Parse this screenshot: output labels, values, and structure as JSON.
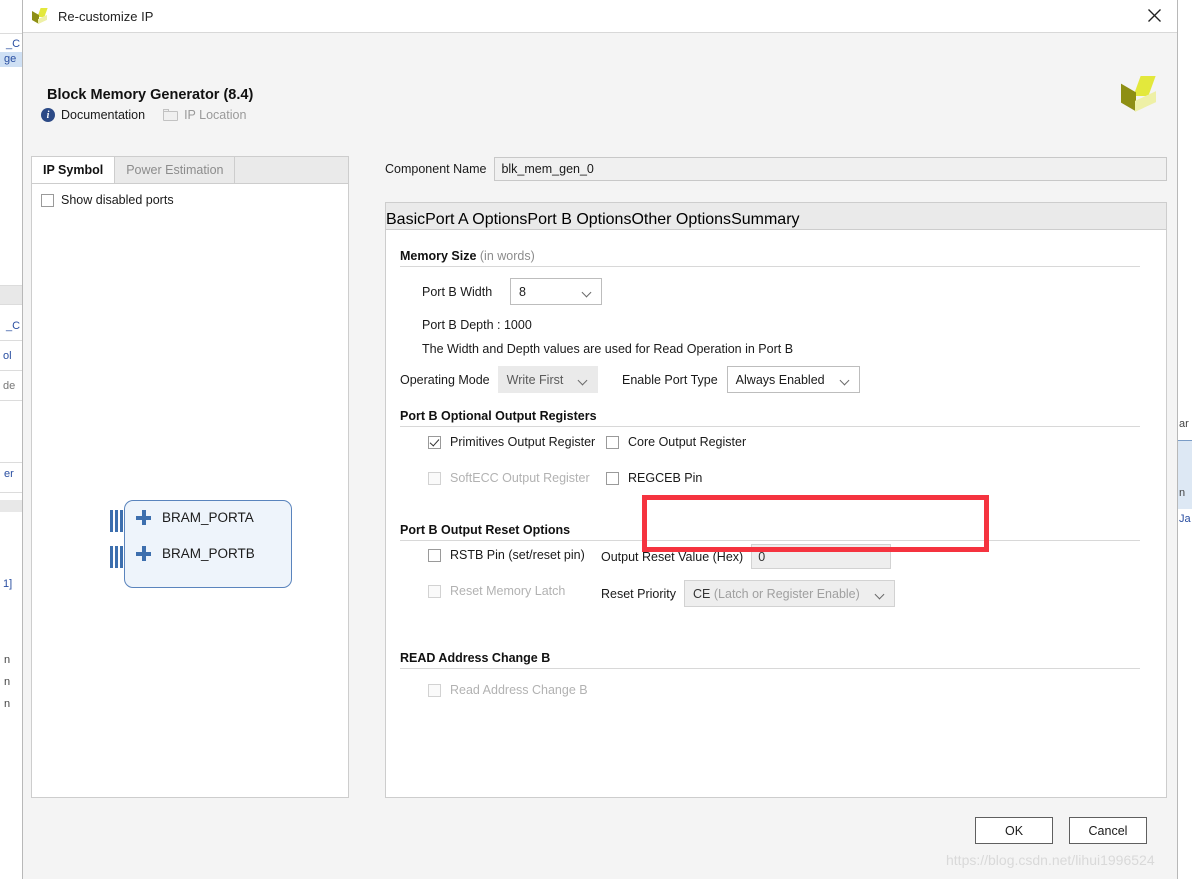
{
  "window": {
    "title": "Re-customize IP",
    "close_icon": "close-icon",
    "logo_icon": "xilinx-logo-icon"
  },
  "header": {
    "ip_title": "Block Memory Generator (8.4)",
    "links": [
      {
        "label": "Documentation",
        "icon": "info-icon",
        "enabled": true
      },
      {
        "label": "IP Location",
        "icon": "folder-icon",
        "enabled": false
      }
    ]
  },
  "left_panel": {
    "tabs": [
      {
        "label": "IP Symbol",
        "active": true
      },
      {
        "label": "Power Estimation",
        "active": false
      }
    ],
    "show_disabled_ports": {
      "label": "Show disabled ports",
      "checked": false
    },
    "symbol": {
      "ports": [
        {
          "label": "BRAM_PORTA",
          "expand_icon": "plus-icon"
        },
        {
          "label": "BRAM_PORTB",
          "expand_icon": "plus-icon"
        }
      ]
    }
  },
  "component": {
    "name_label": "Component Name",
    "name_value": "blk_mem_gen_0"
  },
  "option_tabs": [
    {
      "label": "Basic",
      "active": false
    },
    {
      "label": "Port A Options",
      "active": false
    },
    {
      "label": "Port B Options",
      "active": true
    },
    {
      "label": "Other Options",
      "active": false
    },
    {
      "label": "Summary",
      "active": false
    }
  ],
  "port_b": {
    "memory_size": {
      "title": "Memory Size",
      "title_sub": " (in words)",
      "width_label": "Port B Width",
      "width_value": "8",
      "depth_text": "Port B Depth : 1000",
      "note_text": "The Width and Depth values are used for Read Operation in Port B",
      "operating_mode_label": "Operating Mode",
      "operating_mode_value": "Write First",
      "enable_port_type_label": "Enable Port Type",
      "enable_port_type_value": "Always Enabled"
    },
    "optional_output_registers": {
      "title": "Port B Optional Output Registers",
      "items": [
        {
          "label": "Primitives Output Register",
          "checked": true,
          "enabled": true
        },
        {
          "label": "Core Output Register",
          "checked": false,
          "enabled": true
        },
        {
          "label": "SoftECC Output Register",
          "checked": false,
          "enabled": false
        },
        {
          "label": "REGCEB Pin",
          "checked": false,
          "enabled": true
        }
      ]
    },
    "output_reset_options": {
      "title": "Port B Output Reset Options",
      "rstb_pin": {
        "label": "RSTB Pin (set/reset pin)",
        "checked": false,
        "enabled": true
      },
      "reset_memory_latch": {
        "label": "Reset Memory Latch",
        "checked": false,
        "enabled": false
      },
      "output_reset_value_label": "Output Reset Value (Hex)",
      "output_reset_value": "0",
      "reset_priority_label": "Reset Priority",
      "reset_priority_value": "CE",
      "reset_priority_value_sub": " (Latch or Register Enable)"
    },
    "read_address_change": {
      "title": "READ Address Change B",
      "checkbox": {
        "label": "Read Address Change B",
        "checked": false,
        "enabled": false
      }
    }
  },
  "annotation": {
    "highlight_color": "#f5333f",
    "highlights": "enable-port-type"
  },
  "footer": {
    "ok_label": "OK",
    "cancel_label": "Cancel"
  },
  "watermark": {
    "text": "https://blog.csdn.net/lihui1996524"
  },
  "background_fragments": {
    "left": [
      "_C",
      "ge",
      "_C",
      "ol",
      "de",
      "er",
      "1]",
      "n",
      "n",
      "n"
    ],
    "right": [
      "ar",
      "n",
      "Ja"
    ]
  }
}
